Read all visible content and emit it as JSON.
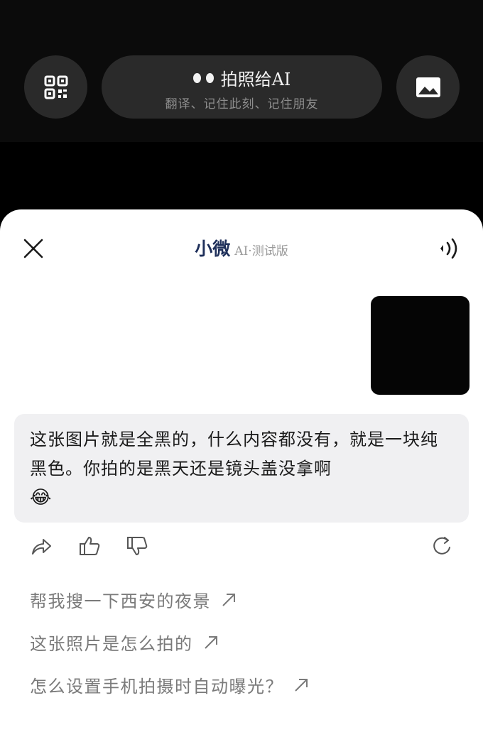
{
  "camera": {
    "title": "拍照给AI",
    "subtitle": "翻译、记住此刻、记住朋友",
    "icons": {
      "left": "qr-code-icon",
      "right": "image-gallery-icon",
      "pill": "two-dots-icon"
    }
  },
  "header": {
    "app_name": "小微",
    "tag": "AI·测试版",
    "close_icon": "close-icon",
    "sound_icon": "sound-icon"
  },
  "conversation": {
    "user_photo": "black-photo",
    "ai_reply": "这张图片就是全黑的，什么内容都没有，就是一块纯黑色。你拍的是黑天还是镜头盖没拿啊",
    "ai_emoji": "😂"
  },
  "actions": {
    "icons": [
      "share-icon",
      "thumbs-up-icon",
      "thumbs-down-icon",
      "regenerate-icon"
    ]
  },
  "suggestions": [
    {
      "label": "帮我搜一下西安的夜景"
    },
    {
      "label": "这张照片是怎么拍的"
    },
    {
      "label": "怎么设置手机拍摄时自动曝光？"
    }
  ],
  "colors": {
    "accent": "#1e2f5a",
    "bubble_bg": "#f0f0f2",
    "suggestion_text": "#7a7a7a"
  }
}
